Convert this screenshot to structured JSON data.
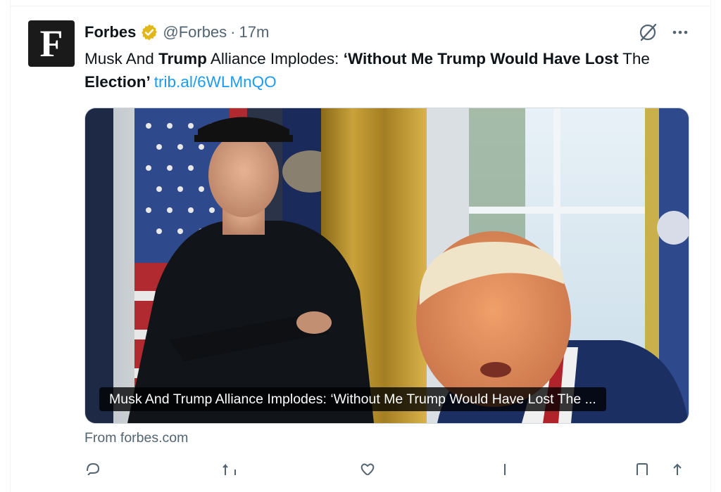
{
  "tweet": {
    "author_initial": "F",
    "author_name": "Forbes",
    "handle": "@Forbes",
    "separator": "·",
    "time": "17m",
    "text_parts": [
      "Musk And ",
      "Trump",
      " Alliance Implodes: ",
      "‘Without Me Trump Would Have Lost",
      " The ",
      "Election",
      "’"
    ],
    "link": "trib.al/6WLMnQO",
    "media_caption": "Musk And Trump Alliance Implodes: ‘Without Me Trump Would Have Lost The ...",
    "source": "From forbes.com"
  },
  "icons": {
    "verified": "verified-badge-icon",
    "grok": "grok-icon",
    "more": "more-dots-icon",
    "reply": "reply-icon",
    "retweet": "retweet-icon",
    "like": "like-icon",
    "views": "views-icon",
    "bookmark": "bookmark-icon",
    "share": "share-icon"
  },
  "colors": {
    "text": "#0f1419",
    "secondary": "#536471",
    "link": "#1d9bf0",
    "verified_gold": "#e2b719"
  }
}
